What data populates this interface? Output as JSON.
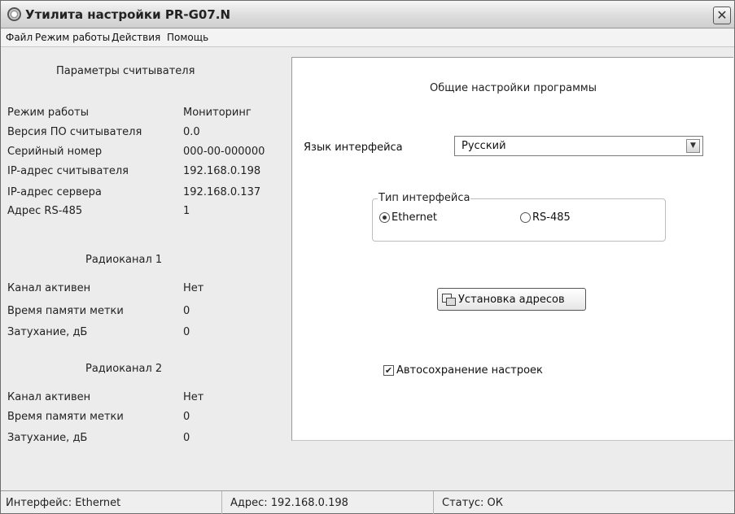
{
  "window": {
    "title": "Утилита настройки PR-G07.N",
    "close_glyph": "✕"
  },
  "menu": [
    {
      "label": "Файл"
    },
    {
      "label": "Режим работы"
    },
    {
      "label": "Действия"
    },
    {
      "label": "Помощь"
    }
  ],
  "reader": {
    "title": "Параметры считывателя",
    "rows": [
      {
        "label": "Режим работы",
        "value": "Мониторинг"
      },
      {
        "label": "Версия ПО считывателя",
        "value": "0.0"
      },
      {
        "label": "Серийный номер",
        "value": "000-00-000000"
      },
      {
        "label": "IP-адрес считывателя",
        "value": "192.168.0.198"
      },
      {
        "label": "IP-адрес сервера",
        "value": "192.168.0.137"
      },
      {
        "label": "Адрес RS-485",
        "value": "1"
      }
    ]
  },
  "radio1": {
    "title": "Радиоканал 1",
    "rows": [
      {
        "label": "Канал активен",
        "value": "Нет"
      },
      {
        "label": "Время памяти метки",
        "value": "0"
      },
      {
        "label": "Затухание, дБ",
        "value": "0"
      }
    ]
  },
  "radio2": {
    "title": "Радиоканал 2",
    "rows": [
      {
        "label": "Канал активен",
        "value": "Нет"
      },
      {
        "label": "Время памяти метки",
        "value": "0"
      },
      {
        "label": "Затухание, дБ",
        "value": "0"
      }
    ]
  },
  "settings": {
    "title": "Общие настройки программы",
    "language_label": "Язык интерфейса",
    "language_value": "Русский",
    "interface_group": "Тип интерфейса",
    "interface_options": [
      {
        "label": "Ethernet",
        "checked": true
      },
      {
        "label": "RS-485",
        "checked": false
      }
    ],
    "address_button": "Установка адресов",
    "autosave_label": "Автосохранение настроек",
    "autosave_checked": true,
    "check_glyph": "✔",
    "dropdown_glyph": "▼"
  },
  "status": {
    "interface": "Интерфейс: Ethernet",
    "address": "Адрес: 192.168.0.198",
    "status": "Статус: ОК"
  }
}
